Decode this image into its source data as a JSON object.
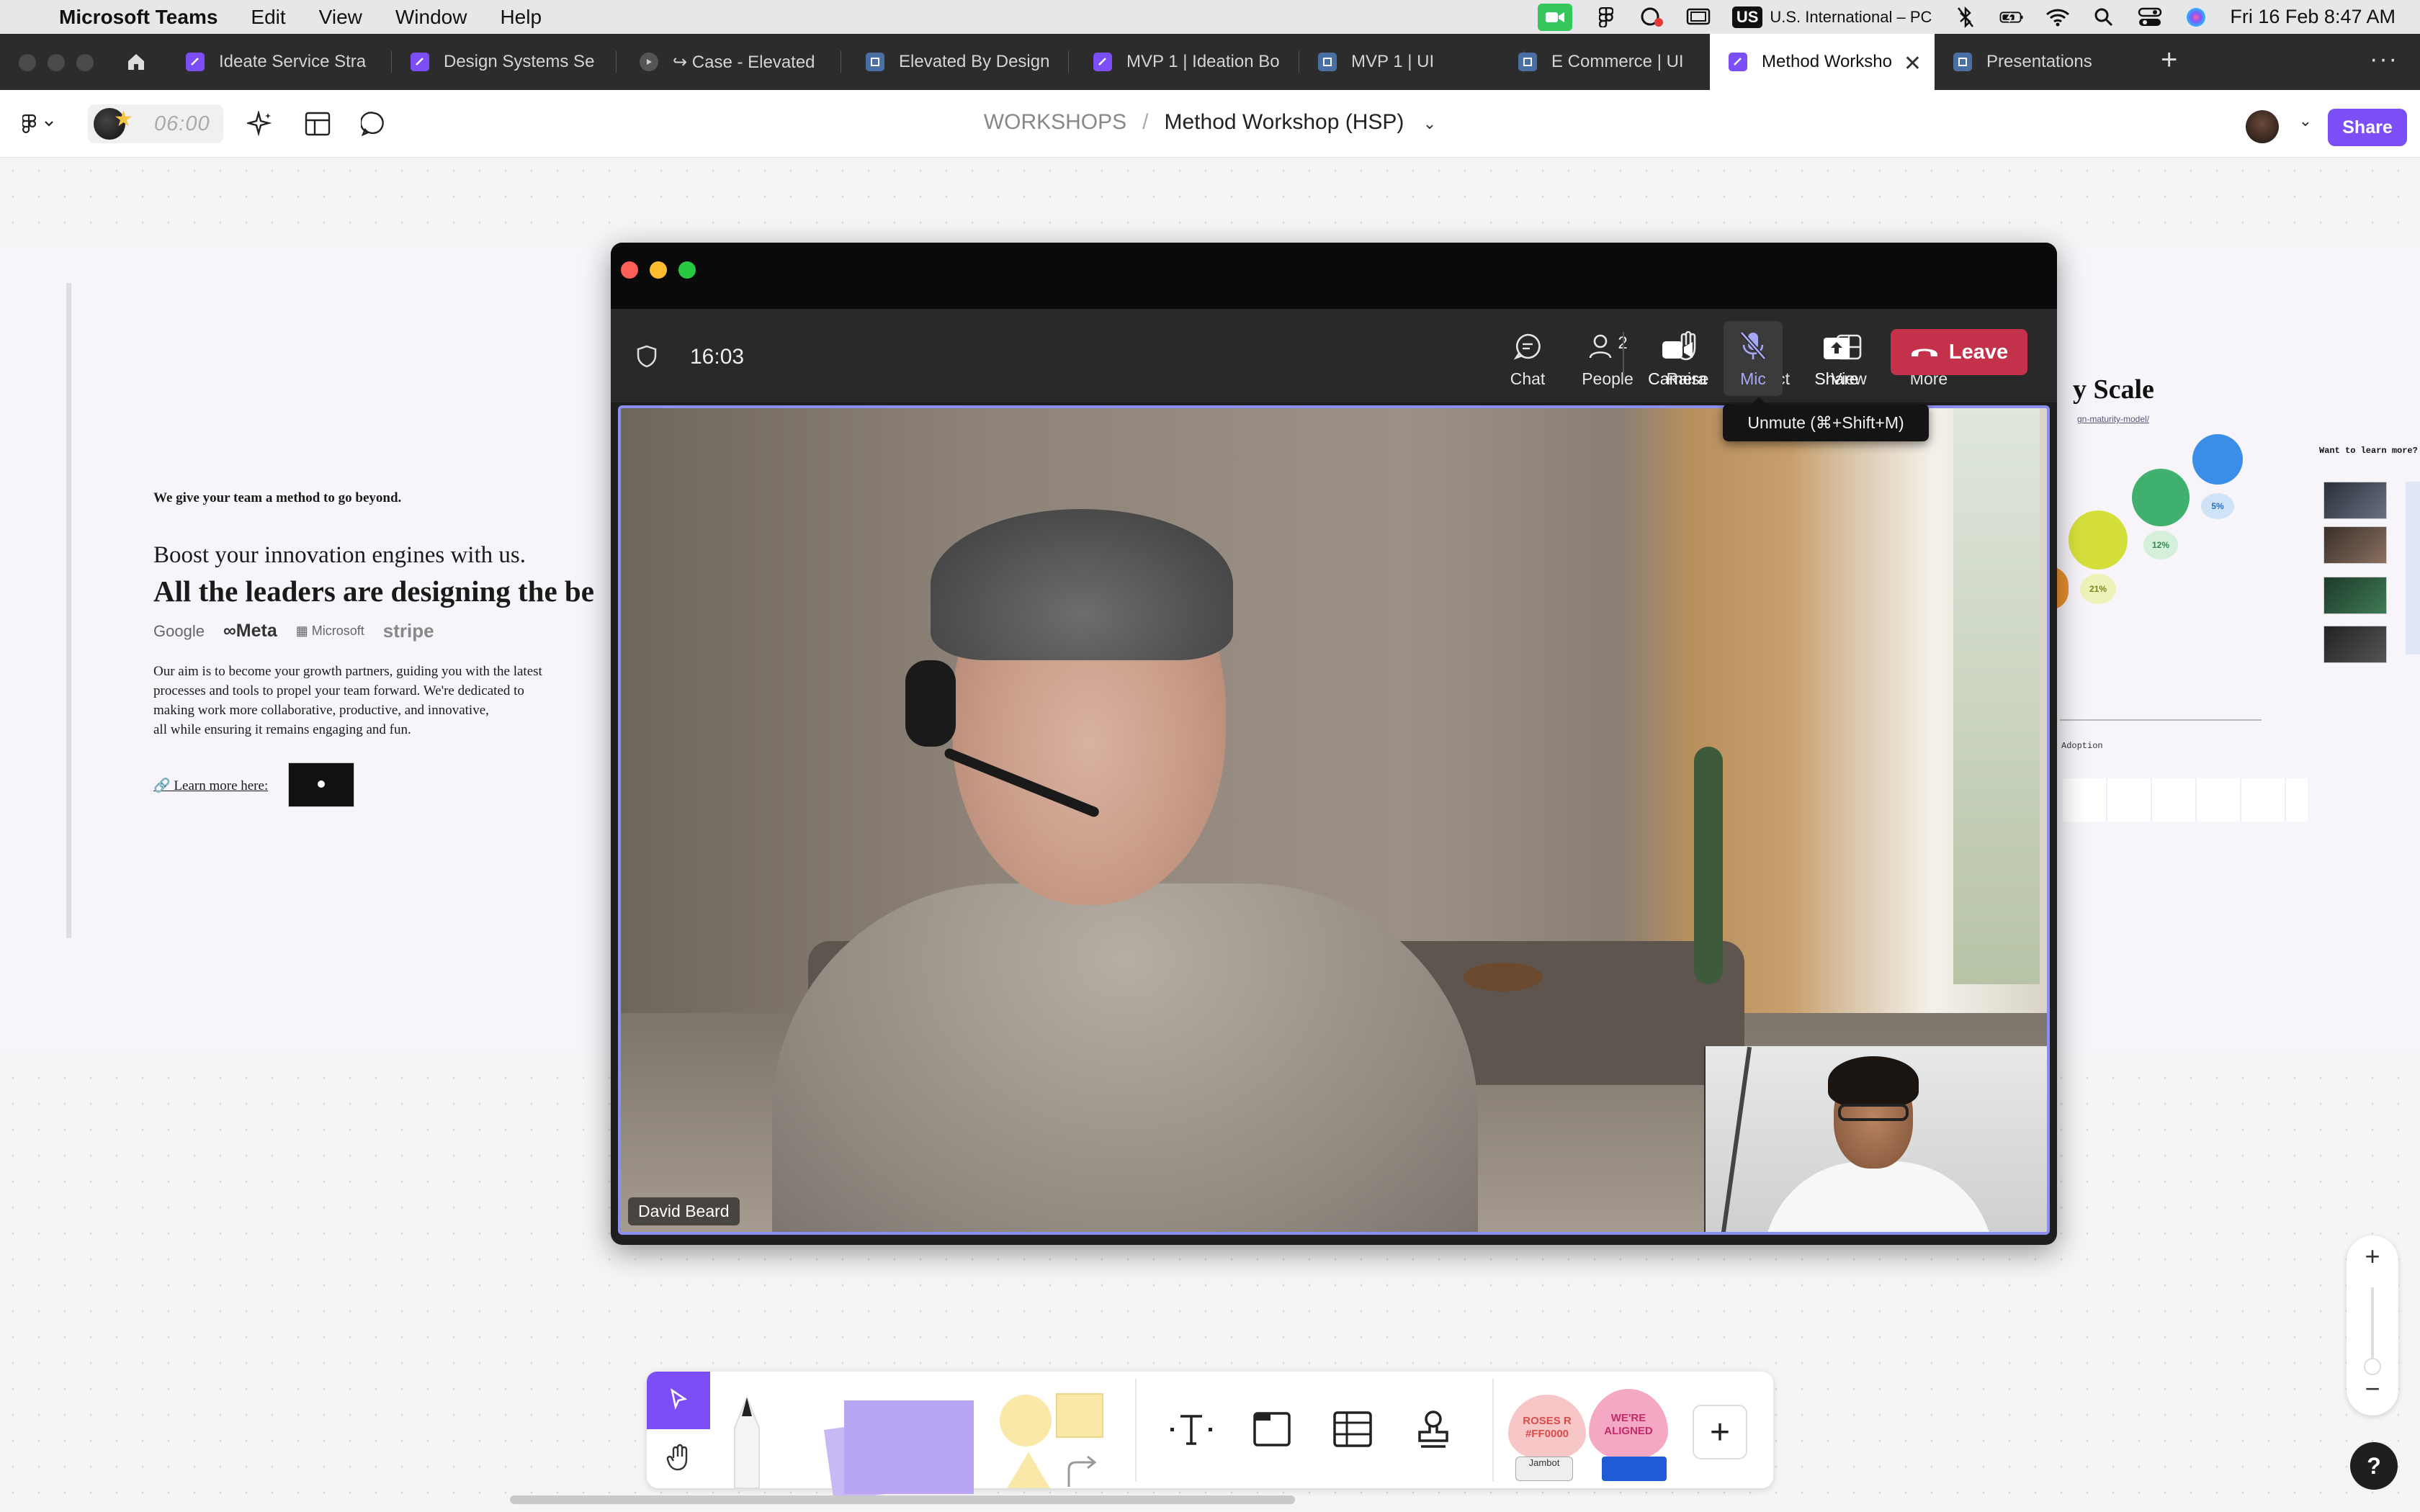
{
  "menubar": {
    "app_name": "Microsoft Teams",
    "menus": [
      "Edit",
      "View",
      "Window",
      "Help"
    ],
    "keyboard_badge": "US",
    "keyboard_layout": "U.S. International – PC",
    "datetime": "Fri 16 Feb  8:47 AM"
  },
  "tabs": [
    {
      "label": "Ideate Service Stra",
      "icon": "figjam-icon",
      "color": "#7b4ef8"
    },
    {
      "label": "Design Systems Se",
      "icon": "figjam-icon",
      "color": "#7b4ef8"
    },
    {
      "label": "↪ Case - Elevated",
      "icon": "play-icon",
      "color": "#555555"
    },
    {
      "label": "Elevated By Design",
      "icon": "figma-slides-icon",
      "color": "#4a6fa5"
    },
    {
      "label": "MVP 1 | Ideation Bo",
      "icon": "figjam-icon",
      "color": "#7b4ef8"
    },
    {
      "label": "MVP 1 | UI",
      "icon": "figma-design-icon",
      "color": "#4a6fa5"
    },
    {
      "label": "E Commerce | UI",
      "icon": "figma-design-icon",
      "color": "#4a6fa5"
    },
    {
      "label": "Method Worksho",
      "icon": "figjam-icon",
      "color": "#7b4ef8"
    },
    {
      "label": "Presentations",
      "icon": "figma-design-icon",
      "color": "#4a6fa5"
    }
  ],
  "figma": {
    "timer": "06:00",
    "breadcrumb_parent": "WORKSHOPS",
    "breadcrumb_separator": "/",
    "file_name": "Method Workshop (HSP)",
    "share_label": "Share"
  },
  "canvas": {
    "tagline": "We give your team a method to go beyond.",
    "boost": "Boost your innovation engines with us.",
    "leaders": "All the leaders are designing the be",
    "logos": [
      "Google",
      "Meta",
      "Microsoft",
      "stripe"
    ],
    "aim_lines": [
      "Our aim is to become your growth partners, guiding you with the latest",
      "processes and tools to propel your team forward. We're dedicated to",
      "making work more collaborative, productive, and innovative,",
      "all while ensuring it remains engaging and fun."
    ],
    "learn_more": "🔗 Learn more here:",
    "scale_title": "y Scale",
    "scale_link": "gn-maturity-model/",
    "percents": [
      "5%",
      "12%",
      "21%"
    ],
    "want_more": "Want to learn more?",
    "adoption": "Adoption"
  },
  "teams": {
    "call_time": "16:03",
    "people_count": "2",
    "buttons": {
      "chat": "Chat",
      "people": "People",
      "raise": "Raise",
      "react": "React",
      "view": "View",
      "more": "More",
      "camera": "Camera",
      "mic": "Mic",
      "share": "Share"
    },
    "leave_label": "Leave",
    "tooltip": "Unmute (⌘+Shift+M)",
    "participant_name": "David Beard",
    "accent": "#8b8ff0",
    "leave_color": "#c4314b"
  },
  "whiteboard_tools": {
    "sticker_1": "ROSES R #FF0000",
    "sticker_2": "WE'RE ALIGNED",
    "sticker_3": "Jambot"
  },
  "zoom": {
    "plus": "+",
    "minus": "−"
  },
  "help_label": "?"
}
